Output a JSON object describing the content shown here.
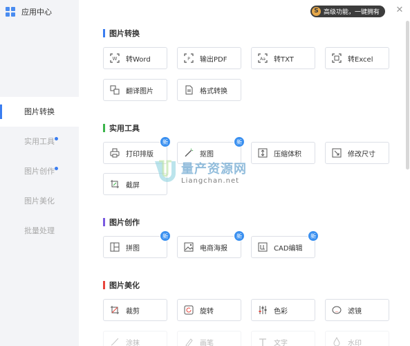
{
  "app": {
    "title": "应用中心"
  },
  "promo": {
    "coin": "S",
    "text": "高级功能，一键拥有"
  },
  "close_label": "✕",
  "nav": [
    {
      "label": "图片转换",
      "active": true,
      "dot": false
    },
    {
      "label": "实用工具",
      "active": false,
      "dot": true
    },
    {
      "label": "图片创作",
      "active": false,
      "dot": true
    },
    {
      "label": "图片美化",
      "active": false,
      "dot": false
    },
    {
      "label": "批量处理",
      "active": false,
      "dot": false
    }
  ],
  "badge_label": "新",
  "sections": {
    "convert": {
      "title": "图片转换",
      "color": "#3a7df0",
      "tools": [
        {
          "label": "转Word",
          "icon": "word-icon"
        },
        {
          "label": "输出PDF",
          "icon": "pdf-icon"
        },
        {
          "label": "转TXT",
          "icon": "txt-icon"
        },
        {
          "label": "转Excel",
          "icon": "excel-icon"
        },
        {
          "label": "翻译图片",
          "icon": "translate-icon"
        },
        {
          "label": "格式转换",
          "icon": "document-icon"
        }
      ]
    },
    "utility": {
      "title": "实用工具",
      "color": "#3cb44b",
      "tools": [
        {
          "label": "打印排版",
          "icon": "printer-icon",
          "new": true
        },
        {
          "label": "抠图",
          "icon": "wand-icon",
          "new": true
        },
        {
          "label": "压缩体积",
          "icon": "compress-icon"
        },
        {
          "label": "修改尺寸",
          "icon": "resize-icon"
        },
        {
          "label": "截屏",
          "icon": "screenshot-icon"
        }
      ]
    },
    "create": {
      "title": "图片创作",
      "color": "#7a5ae0",
      "tools": [
        {
          "label": "拼图",
          "icon": "collage-icon",
          "new": true
        },
        {
          "label": "电商海报",
          "icon": "poster-icon",
          "new": true
        },
        {
          "label": "CAD编辑",
          "icon": "cad-icon",
          "new": true
        }
      ]
    },
    "beautify": {
      "title": "图片美化",
      "color": "#e8453c",
      "tools": [
        {
          "label": "裁剪",
          "icon": "crop-icon"
        },
        {
          "label": "旋转",
          "icon": "rotate-icon"
        },
        {
          "label": "色彩",
          "icon": "sliders-icon"
        },
        {
          "label": "滤镜",
          "icon": "filter-icon"
        },
        {
          "label": "涂抹",
          "icon": "smudge-icon"
        },
        {
          "label": "画笔",
          "icon": "brush-icon"
        },
        {
          "label": "文字",
          "icon": "text-icon"
        },
        {
          "label": "水印",
          "icon": "watermark-icon"
        }
      ]
    }
  },
  "watermark": {
    "main": "量产资源网",
    "sub": "Liangchan.net"
  }
}
